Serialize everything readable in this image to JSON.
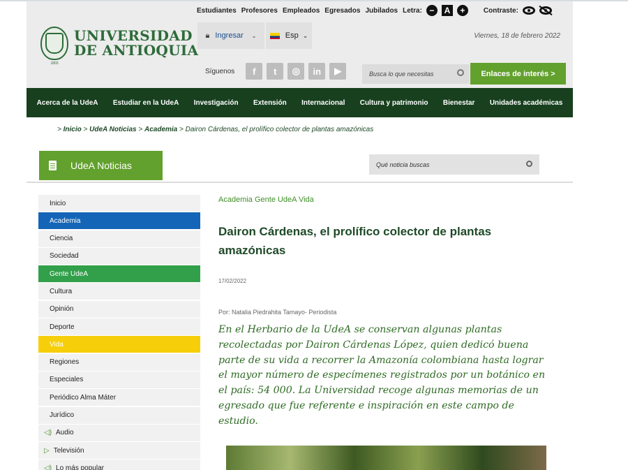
{
  "logo": {
    "line1": "UNIVERSIDAD",
    "line2": "DE ANTIOQUIA",
    "seal_year": "1803"
  },
  "topbar": {
    "links": [
      "Estudiantes",
      "Profesores",
      "Empleados",
      "Egresados",
      "Jubilados"
    ],
    "letra_label": "Letra:",
    "contraste_label": "Contraste:",
    "font_minus": "−",
    "font_reset": "A",
    "font_plus": "+"
  },
  "login": {
    "label": "Ingresar",
    "lang": "Esp"
  },
  "date": "Viernes, 18 de febrero 2022",
  "social": {
    "label": "Síguenos",
    "icons": [
      "f",
      "t",
      "◎",
      "in",
      "▶"
    ]
  },
  "header_search": {
    "placeholder": "Busca lo que necesitas"
  },
  "links_button": "Enlaces de interés  >",
  "nav": [
    "Acerca de la UdeA",
    "Estudiar en la UdeA",
    "Investigación",
    "Extensión",
    "Internacional",
    "Cultura y patrimonio",
    "Bienestar",
    "Unidades académicas"
  ],
  "breadcrumb": {
    "sep": ">",
    "items": [
      "Inicio",
      "UdeA Noticias",
      "Academia"
    ],
    "current": "Dairon Cárdenas, el prolífico colector de plantas amazónicas"
  },
  "noticias": {
    "label": "UdeA Noticias",
    "search_placeholder": "Qué noticia buscas"
  },
  "sidebar": [
    {
      "label": "Inicio"
    },
    {
      "label": "Academia"
    },
    {
      "label": "Ciencia"
    },
    {
      "label": "Sociedad"
    },
    {
      "label": "Gente UdeA"
    },
    {
      "label": "Cultura"
    },
    {
      "label": "Opinión"
    },
    {
      "label": "Deporte"
    },
    {
      "label": "Vida"
    },
    {
      "label": "Regiones"
    },
    {
      "label": "Especiales"
    },
    {
      "label": "Periódico Alma Máter"
    },
    {
      "label": "Jurídico"
    },
    {
      "label": "Audio",
      "icon": "◁)"
    },
    {
      "label": "Televisión",
      "icon": "▷"
    },
    {
      "label": "Lo más popular",
      "icon": "◁)"
    }
  ],
  "article": {
    "categories": "Academia Gente UdeA Vida",
    "title": "Dairon Cárdenas, el prolífico colector de plantas amazónicas",
    "date": "17/02/2022",
    "author": "Por: Natalia Piedrahita Tamayo- Periodista",
    "lead": "En el Herbario de la UdeA se conservan algunas plantas recolectadas por Dairon Cárdenas López, quien dedicó buena parte de su vida a recorrer la Amazonía colombiana hasta lograr el mayor número de especímenes registrados por un botánico en el país: 54 000. La Universidad recoge algunas memorias de un egresado que fue referente e inspiración en este campo de estudio."
  },
  "colors": {
    "dark_green": "#18401f",
    "accent_green": "#62a12d",
    "blue": "#1465b7",
    "gente_green": "#32a04a",
    "yellow": "#f6cf0a"
  }
}
